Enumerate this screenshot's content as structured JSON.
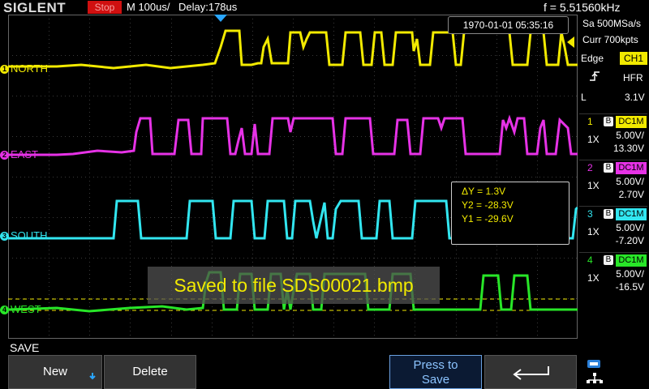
{
  "header": {
    "brand": "SIGLENT",
    "run_state": "Stop",
    "timebase": "M 100us/",
    "delay": "Delay:178us",
    "frequency": "f = 5.51560kHz"
  },
  "timestamp": "1970-01-01 05:35:16",
  "channels": [
    {
      "num": "1",
      "name": "NORTH",
      "color": "#f2ea00"
    },
    {
      "num": "2",
      "name": "EAST",
      "color": "#e632e6"
    },
    {
      "num": "3",
      "name": "SOUTH",
      "color": "#32e6f0"
    },
    {
      "num": "4",
      "name": "WEST",
      "color": "#28e628"
    }
  ],
  "cursor_readout": {
    "delta_y": "ΔY = 1.3V",
    "y2": "Y2 = -28.3V",
    "y1": "Y1 = -29.6V"
  },
  "saved_message": "Saved to file SDS00021.bmp",
  "acquisition": {
    "sample_rate": "Sa 500MSa/s",
    "memory": "Curr 700kpts"
  },
  "trigger": {
    "type": "Edge",
    "source": "CH1",
    "coupling": "HFR",
    "level_label": "L",
    "level": "3.1V"
  },
  "channel_panels": [
    {
      "num": "1",
      "bw": "B",
      "coupling": "DC1M",
      "probe": "1X",
      "vdiv": "5.00V/",
      "offset": "13.30V",
      "color": "#f2ea00"
    },
    {
      "num": "2",
      "bw": "B",
      "coupling": "DC1M",
      "probe": "1X",
      "vdiv": "5.00V/",
      "offset": "2.70V",
      "color": "#e632e6"
    },
    {
      "num": "3",
      "bw": "B",
      "coupling": "DC1M",
      "probe": "1X",
      "vdiv": "5.00V/",
      "offset": "-7.20V",
      "color": "#32e6f0"
    },
    {
      "num": "4",
      "bw": "B",
      "coupling": "DC1M",
      "probe": "1X",
      "vdiv": "5.00V/",
      "offset": "-16.5V",
      "color": "#28e628"
    }
  ],
  "menu": {
    "title": "SAVE",
    "new_label": "New",
    "delete_label": "Delete",
    "press_to_save_label_1": "Press to",
    "press_to_save_label_2": "Save"
  },
  "icons": {
    "trigger_position": "trigger-position-marker",
    "trigger_slope": "rising-edge-icon",
    "back": "return-arrow-icon",
    "network": "network-icon",
    "new_arrow": "down-arrow-icon"
  }
}
